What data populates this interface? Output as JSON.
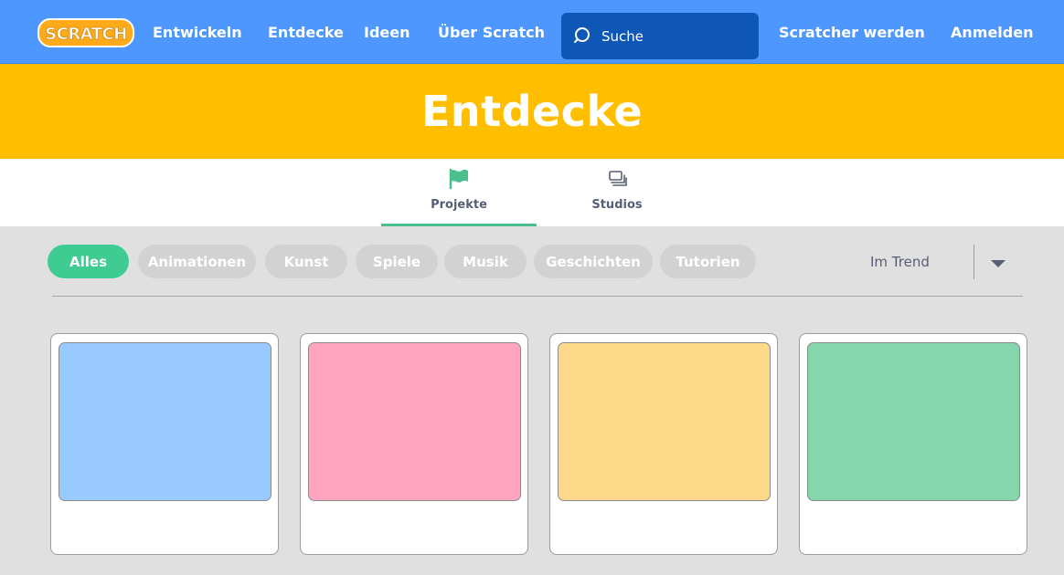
{
  "nav": {
    "logo_text": "SCRATCH",
    "links": [
      {
        "label": "Entwickeln"
      },
      {
        "label": "Entdecke"
      },
      {
        "label": "Ideen"
      },
      {
        "label": "Über Scratch"
      }
    ],
    "search_placeholder": "Suche",
    "join_label": "Scratcher werden",
    "signin_label": "Anmelden"
  },
  "banner": {
    "title": "Entdecke"
  },
  "tabs": [
    {
      "label": "Projekte",
      "icon": "flag-icon",
      "active": true
    },
    {
      "label": "Studios",
      "icon": "studios-icon",
      "active": false
    }
  ],
  "filters": [
    {
      "label": "Alles",
      "active": true
    },
    {
      "label": "Animationen"
    },
    {
      "label": "Kunst"
    },
    {
      "label": "Spiele"
    },
    {
      "label": "Musik"
    },
    {
      "label": "Geschichten"
    },
    {
      "label": "Tutorien"
    }
  ],
  "sort": {
    "selected": "Im Trend"
  },
  "colors": {
    "nav": "#4d97ff",
    "banner": "#ffbf00",
    "accent_green": "#3ecc93",
    "search_bg": "#0f57b7"
  },
  "cards": [
    {
      "thumb_color": "#99caff"
    },
    {
      "thumb_color": "#ffa5c0"
    },
    {
      "thumb_color": "#ffd98a"
    },
    {
      "thumb_color": "#85d6ad"
    }
  ]
}
